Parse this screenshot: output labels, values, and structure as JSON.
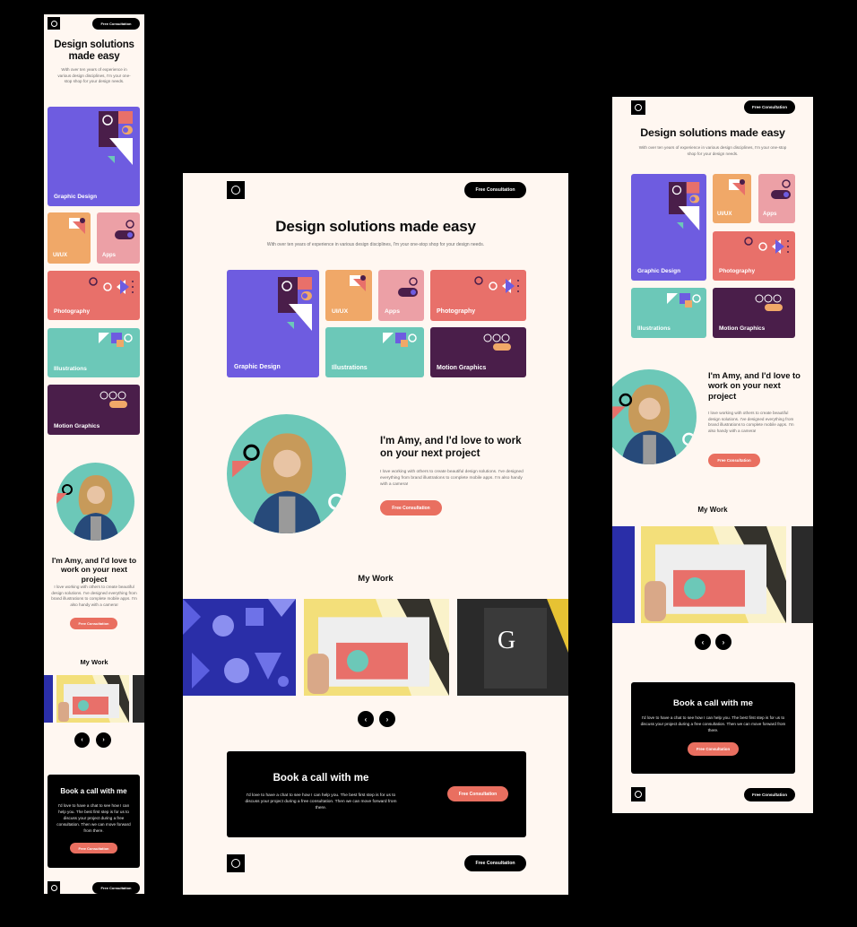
{
  "brand": {
    "logo_icon": "circle-logo-icon"
  },
  "nav": {
    "cta_label": "Free Consultation"
  },
  "hero": {
    "title": "Design solutions made easy",
    "mobile_title_line1": "Design solutions",
    "mobile_title_line2": "made easy",
    "subtitle": "With over ten years of experience in various design disciplines, I'm your one-stop shop for your design needs."
  },
  "services": [
    {
      "label": "Graphic Design",
      "color": "#6e5ce0"
    },
    {
      "label": "UI/UX",
      "color": "#f0a868"
    },
    {
      "label": "Apps",
      "color": "#eca0a6"
    },
    {
      "label": "Photography",
      "color": "#e8706a"
    },
    {
      "label": "Illustrations",
      "color": "#6cc8b8"
    },
    {
      "label": "Motion Graphics",
      "color": "#4a1e4a"
    }
  ],
  "about": {
    "title": "I'm Amy, and I'd love to work on your next project",
    "text": "I love working with others to create beautiful design solutions. I've designed everything from brand illustrations to complete mobile apps. I'm also handy with a camera!",
    "cta_label": "Free Consultation"
  },
  "work": {
    "title": "My Work",
    "items": [
      {
        "name": "Geometric pattern artwork"
      },
      {
        "name": "Newspaper mockup in hand"
      },
      {
        "name": "Graphic design book"
      }
    ],
    "prev_icon": "chevron-left-icon",
    "next_icon": "chevron-right-icon"
  },
  "contact": {
    "title": "Book a call with me",
    "text": "I'd love to have a chat to see how I can help you. The best first step is for us to discuss your project during a free consultation. Then we can move forward from there.",
    "cta_label": "Free Consultation"
  },
  "colors": {
    "background": "#fff7f1",
    "accent": "#e96f60",
    "ink": "#000000"
  }
}
